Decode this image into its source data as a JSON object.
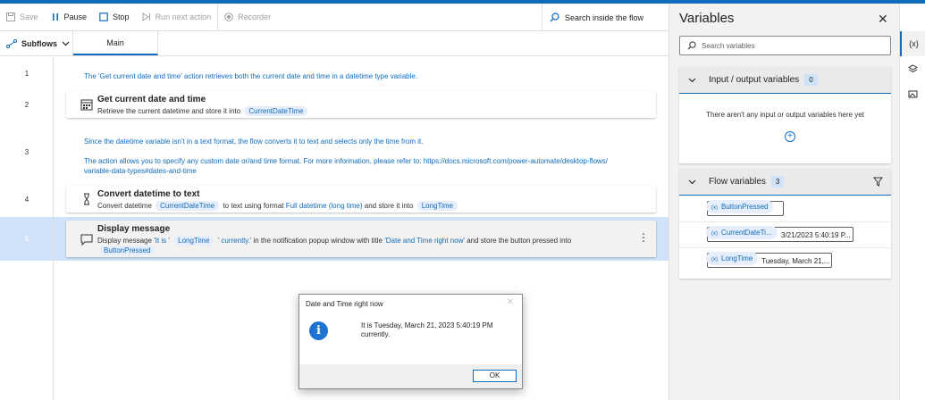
{
  "toolbar": {
    "save": "Save",
    "pause": "Pause",
    "stop": "Stop",
    "run_next": "Run next action",
    "recorder": "Recorder",
    "search": "Search inside the flow"
  },
  "tabs": {
    "subflows": "Subflows",
    "main": "Main"
  },
  "lines": [
    "1",
    "2",
    "3",
    "4",
    "5"
  ],
  "flow": {
    "comment1": "The 'Get current date and time' action retrieves both the current date and time in a datetime type variable.",
    "action2": {
      "title": "Get current date and time",
      "desc_prefix": "Retrieve the current datetime and store it into",
      "var": "CurrentDateTime"
    },
    "comment3a": "Since the datetime variable isn't in a text format, the flow converts it to text and selects only the time from it.",
    "comment3b": "The action allows you to specify any custom date or/and time format. For more information, please refer to: https://docs.microsoft.com/power-automate/desktop-flows/",
    "comment3c": "variable-data-types#dates-and-time",
    "action4": {
      "title": "Convert datetime to text",
      "p1": "Convert datetime",
      "var1": "CurrentDateTime",
      "p2": "to text using format",
      "format": "Full datetime (long time)",
      "p3": "and store it into",
      "var2": "LongTime"
    },
    "action5": {
      "title": "Display message",
      "p1": "Display message",
      "q1": "'It is '",
      "var1": "LongTime",
      "q2": "' currently.'",
      "p2": "in the notification popup window with title",
      "popup_title": "'Date and Time right now'",
      "p3": "and store the button pressed into",
      "var2": "ButtonPressed"
    }
  },
  "popup": {
    "title": "Date and Time right now",
    "message": "It is Tuesday, March 21, 2023 5:40:19 PM currently.",
    "ok": "OK"
  },
  "variables": {
    "title": "Variables",
    "search_placeholder": "Search variables",
    "io_section": "Input / output variables",
    "io_count": "0",
    "io_empty": "There aren't any input or output variables here yet",
    "flow_section": "Flow variables",
    "flow_count": "3",
    "flow_vars": [
      {
        "name": "ButtonPressed",
        "value": ""
      },
      {
        "name": "CurrentDateTi...",
        "value": "3/21/2023 5:40:19 P..."
      },
      {
        "name": "LongTime",
        "value": "Tuesday, March 21,..."
      }
    ]
  },
  "rail": {
    "vars_icon": "{x}"
  },
  "colors": {
    "accent": "#0f6cbd",
    "selected_row": "#cfe2f9"
  }
}
